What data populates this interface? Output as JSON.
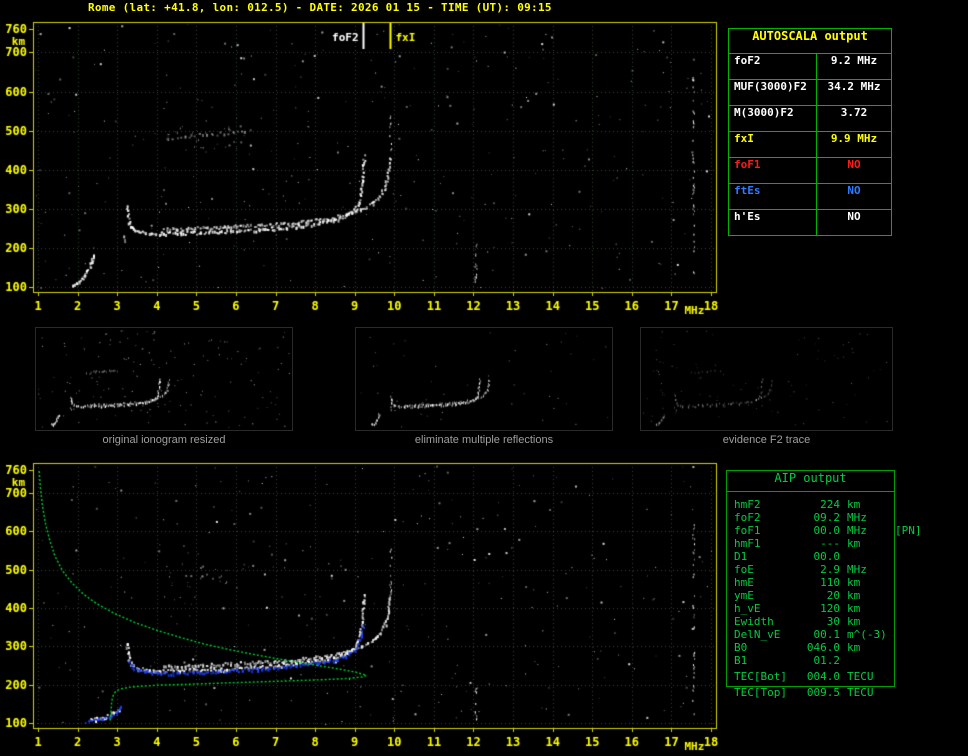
{
  "header": {
    "title": "Rome (lat: +41.8, lon: 012.5) - DATE: 2026 01 15 - TIME (UT): 09:15"
  },
  "colors": {
    "accent_yellow": "#ffff00",
    "plot_border": "#d4d400",
    "table_border_green": "#00b400",
    "aip_green": "#00cc44",
    "trace_white": "#ffffff",
    "restored_blue": "#2244ff",
    "profile_green": "#00cc33",
    "caption_gray": "#9f9f9f",
    "alert_red": "#ff1a1a",
    "info_blue": "#2e7bff"
  },
  "autoscala_table": {
    "title": "AUTOSCALA output",
    "rows": [
      {
        "param": "foF2",
        "value": "9.2 MHz",
        "color": "#ffffff"
      },
      {
        "param": "MUF(3000)F2",
        "value": "34.2 MHz",
        "color": "#ffffff"
      },
      {
        "param": "M(3000)F2",
        "value": "3.72",
        "color": "#ffffff"
      },
      {
        "param": "fxI",
        "value": "9.9 MHz",
        "color": "#ffff00"
      },
      {
        "param": "foF1",
        "value": "NO",
        "color": "#ff1a1a"
      },
      {
        "param": "ftEs",
        "value": "NO",
        "color": "#2e7bff"
      },
      {
        "param": "h'Es",
        "value": "NO",
        "color": "#ffffff"
      }
    ]
  },
  "thumbnails": [
    {
      "caption": "original ionogram resized",
      "style": "original"
    },
    {
      "caption": "eliminate multiple reflections",
      "style": "clean"
    },
    {
      "caption": "evidence F2 trace",
      "style": "faint"
    }
  ],
  "aip_panel": {
    "title": "AIP output",
    "rows": [
      {
        "param": "hmF2",
        "value": "224",
        "unit": "km",
        "extra": ""
      },
      {
        "param": "foF2",
        "value": "09.2",
        "unit": "MHz",
        "extra": ""
      },
      {
        "param": "foF1",
        "value": "00.0",
        "unit": "MHz",
        "extra": "[PN]"
      },
      {
        "param": "hmF1",
        "value": "---",
        "unit": "km",
        "extra": ""
      },
      {
        "param": "D1",
        "value": "00.0",
        "unit": "",
        "extra": ""
      },
      {
        "param": "foE",
        "value": "2.9",
        "unit": "MHz",
        "extra": ""
      },
      {
        "param": "hmE",
        "value": "110",
        "unit": "km",
        "extra": ""
      },
      {
        "param": "ymE",
        "value": "20",
        "unit": "km",
        "extra": ""
      },
      {
        "param": "h_vE",
        "value": "120",
        "unit": "km",
        "extra": ""
      },
      {
        "param": "Ewidth",
        "value": "30",
        "unit": "km",
        "extra": ""
      },
      {
        "param": "DelN_vE",
        "value": "00.1",
        "unit": "m^(-3)",
        "extra": ""
      },
      {
        "param": "B0",
        "value": "046.0",
        "unit": "km",
        "extra": ""
      },
      {
        "param": "B1",
        "value": "01.2",
        "unit": "",
        "extra": ""
      }
    ],
    "tec_bot": {
      "param": "TEC[Bot]",
      "value": "004.0",
      "unit": "TECU",
      "extra": ""
    },
    "tec_top": {
      "param": "TEC[Top]",
      "value": "009.5",
      "unit": "TECU",
      "extra": ""
    }
  },
  "chart_data": [
    {
      "type": "scatter",
      "title": "",
      "xlabel": "MHz",
      "ylabel": "km",
      "xlim": [
        1,
        18
      ],
      "ylim": [
        100,
        760
      ],
      "xticks": [
        1,
        2,
        3,
        4,
        5,
        6,
        7,
        8,
        9,
        10,
        11,
        12,
        13,
        14,
        15,
        16,
        17,
        18
      ],
      "yticks": [
        100,
        200,
        300,
        400,
        500,
        600,
        700,
        760
      ],
      "grid": true,
      "markers": [
        {
          "label": "foF2",
          "x": 9.2,
          "color": "#ffffff",
          "side": "left"
        },
        {
          "label": "fxI",
          "x": 9.9,
          "color": "#ffff00",
          "side": "right"
        }
      ],
      "series": [
        {
          "name": "E-region echo",
          "color": "#ffffff",
          "points": [
            [
              1.88,
              103
            ],
            [
              1.96,
              107
            ],
            [
              2.05,
              113
            ],
            [
              2.13,
              121
            ],
            [
              2.21,
              131
            ],
            [
              2.28,
              143
            ],
            [
              2.34,
              157
            ],
            [
              2.39,
              170
            ],
            [
              2.42,
              180
            ]
          ]
        },
        {
          "name": "retardation dots",
          "color": "#ffffff",
          "alpha": 0.8,
          "spacing": 3,
          "points": [
            [
              3.2,
              228
            ],
            [
              3.22,
              214
            ]
          ]
        },
        {
          "name": "F trace ordinary",
          "color": "#ffffff",
          "points": [
            [
              3.25,
              308
            ],
            [
              3.28,
              282
            ],
            [
              3.32,
              260
            ],
            [
              3.4,
              248
            ],
            [
              3.55,
              241
            ],
            [
              3.75,
              238
            ],
            [
              4.1,
              236
            ],
            [
              4.6,
              236
            ],
            [
              5.1,
              238
            ],
            [
              5.6,
              240
            ],
            [
              6.1,
              243
            ],
            [
              6.6,
              246
            ],
            [
              7.1,
              250
            ],
            [
              7.6,
              255
            ],
            [
              8.1,
              262
            ],
            [
              8.5,
              270
            ],
            [
              8.8,
              281
            ],
            [
              9.0,
              295
            ],
            [
              9.1,
              313
            ],
            [
              9.16,
              340
            ],
            [
              9.2,
              374
            ],
            [
              9.23,
              412
            ],
            [
              9.25,
              434
            ]
          ]
        },
        {
          "name": "F trace extraordinary",
          "color": "#ffffff",
          "alpha": 0.85,
          "points": [
            [
              4.2,
              246
            ],
            [
              4.8,
              248
            ],
            [
              5.4,
              251
            ],
            [
              6.0,
              254
            ],
            [
              6.6,
              257
            ],
            [
              7.2,
              261
            ],
            [
              7.8,
              267
            ],
            [
              8.3,
              274
            ],
            [
              8.8,
              284
            ],
            [
              9.15,
              297
            ],
            [
              9.45,
              313
            ],
            [
              9.65,
              333
            ],
            [
              9.78,
              358
            ],
            [
              9.85,
              392
            ],
            [
              9.89,
              428
            ]
          ]
        },
        {
          "name": "second hop echo",
          "color": "#ffffff",
          "alpha": 0.5,
          "spacing": 4,
          "points": [
            [
              4.3,
              478
            ],
            [
              4.85,
              486
            ],
            [
              5.4,
              490
            ],
            [
              5.95,
              494
            ],
            [
              6.35,
              498
            ]
          ]
        }
      ],
      "noise": {
        "seed": 7,
        "count": 330,
        "streaks": [
          {
            "x": 17.55,
            "km_min": 110,
            "km_max": 640,
            "count": 42
          },
          {
            "x": 12.05,
            "km_min": 105,
            "km_max": 225,
            "count": 14
          },
          {
            "x": 9.9,
            "km_min": 450,
            "km_max": 540,
            "count": 10
          }
        ],
        "clusters": [
          {
            "f_min": 4.2,
            "f_max": 6.4,
            "km_min": 455,
            "km_max": 515,
            "count": 26,
            "alpha": 0.5
          }
        ]
      }
    },
    {
      "type": "scatter",
      "title": "",
      "xlabel": "MHz",
      "ylabel": "km",
      "xlim": [
        1,
        18
      ],
      "ylim": [
        100,
        760
      ],
      "xticks": [
        1,
        2,
        3,
        4,
        5,
        6,
        7,
        8,
        9,
        10,
        11,
        12,
        13,
        14,
        15,
        16,
        17,
        18
      ],
      "yticks": [
        100,
        200,
        300,
        400,
        500,
        600,
        700,
        760
      ],
      "grid": true,
      "markers": [],
      "series": [
        {
          "name": "E-region echo",
          "color": "#ffffff",
          "points": [
            [
              2.32,
              106
            ],
            [
              2.52,
              110
            ],
            [
              2.72,
              116
            ],
            [
              2.92,
              125
            ],
            [
              3.06,
              134
            ]
          ]
        },
        {
          "name": "F trace ordinary",
          "color": "#ffffff",
          "points": [
            [
              3.25,
              308
            ],
            [
              3.28,
              282
            ],
            [
              3.32,
              260
            ],
            [
              3.4,
              248
            ],
            [
              3.55,
              241
            ],
            [
              3.75,
              238
            ],
            [
              4.1,
              236
            ],
            [
              4.6,
              236
            ],
            [
              5.1,
              238
            ],
            [
              5.6,
              240
            ],
            [
              6.1,
              243
            ],
            [
              6.6,
              246
            ],
            [
              7.1,
              250
            ],
            [
              7.6,
              255
            ],
            [
              8.1,
              262
            ],
            [
              8.5,
              270
            ],
            [
              8.8,
              281
            ],
            [
              9.0,
              295
            ],
            [
              9.1,
              313
            ],
            [
              9.16,
              340
            ],
            [
              9.2,
              374
            ],
            [
              9.23,
              412
            ],
            [
              9.25,
              434
            ]
          ]
        },
        {
          "name": "F trace extraordinary",
          "color": "#ffffff",
          "alpha": 0.85,
          "points": [
            [
              4.2,
              246
            ],
            [
              4.8,
              248
            ],
            [
              5.4,
              251
            ],
            [
              6.0,
              254
            ],
            [
              6.6,
              257
            ],
            [
              7.2,
              261
            ],
            [
              7.8,
              267
            ],
            [
              8.3,
              274
            ],
            [
              8.8,
              284
            ],
            [
              9.15,
              297
            ],
            [
              9.45,
              313
            ],
            [
              9.65,
              333
            ],
            [
              9.78,
              358
            ],
            [
              9.85,
              392
            ],
            [
              9.89,
              428
            ]
          ]
        },
        {
          "name": "restored trace",
          "color": "#2244ff",
          "points": [
            [
              3.3,
              262
            ],
            [
              3.4,
              246
            ],
            [
              3.55,
              237
            ],
            [
              3.75,
              232
            ],
            [
              4.05,
              229
            ],
            [
              4.55,
              229
            ],
            [
              5.05,
              231
            ],
            [
              5.55,
              233
            ],
            [
              6.05,
              236
            ],
            [
              6.55,
              239
            ],
            [
              7.05,
              243
            ],
            [
              7.55,
              249
            ],
            [
              8.05,
              255
            ],
            [
              8.45,
              263
            ],
            [
              8.8,
              274
            ],
            [
              9.0,
              287
            ],
            [
              9.1,
              302
            ],
            [
              9.17,
              324
            ],
            [
              9.22,
              350
            ]
          ]
        },
        {
          "name": "restored E layer",
          "color": "#2244ff",
          "points": [
            [
              2.22,
              103
            ],
            [
              2.44,
              106
            ],
            [
              2.66,
              111
            ],
            [
              2.88,
              118
            ],
            [
              3.02,
              127
            ],
            [
              3.12,
              139
            ]
          ]
        },
        {
          "name": "electron density profile",
          "color": "#00cc33",
          "style": "line",
          "points": [
            [
              1.03,
              757
            ],
            [
              1.06,
              716
            ],
            [
              1.11,
              668
            ],
            [
              1.19,
              620
            ],
            [
              1.3,
              575
            ],
            [
              1.44,
              533
            ],
            [
              1.62,
              497
            ],
            [
              1.86,
              465
            ],
            [
              2.15,
              436
            ],
            [
              2.5,
              410
            ],
            [
              2.95,
              385
            ],
            [
              3.45,
              362
            ],
            [
              4.0,
              342
            ],
            [
              4.6,
              323
            ],
            [
              5.2,
              306
            ],
            [
              5.9,
              290
            ],
            [
              6.6,
              276
            ],
            [
              7.3,
              263
            ],
            [
              8.0,
              251
            ],
            [
              8.6,
              241
            ],
            [
              9.0,
              233
            ],
            [
              9.22,
              227
            ],
            [
              9.3,
              224
            ],
            [
              9.18,
              220
            ],
            [
              8.8,
              216
            ],
            [
              8.2,
              213
            ],
            [
              7.4,
              210
            ],
            [
              6.5,
              207
            ],
            [
              5.6,
              204
            ],
            [
              4.8,
              201
            ],
            [
              4.1,
              199
            ],
            [
              3.6,
              196
            ],
            [
              3.3,
              193
            ],
            [
              3.1,
              189
            ],
            [
              2.98,
              184
            ],
            [
              2.92,
              177
            ],
            [
              2.88,
              166
            ],
            [
              2.86,
              153
            ],
            [
              2.85,
              139
            ],
            [
              2.84,
              125
            ],
            [
              2.83,
              111
            ],
            [
              2.82,
              101
            ]
          ]
        }
      ],
      "noise": {
        "seed": 13,
        "count": 300,
        "streaks": [
          {
            "x": 17.55,
            "km_min": 110,
            "km_max": 620,
            "count": 40
          },
          {
            "x": 9.9,
            "km_min": 430,
            "km_max": 560,
            "count": 14
          },
          {
            "x": 12.05,
            "km_min": 105,
            "km_max": 200,
            "count": 10
          }
        ],
        "clusters": [
          {
            "f_min": 4.3,
            "f_max": 6.5,
            "km_min": 455,
            "km_max": 520,
            "count": 24,
            "alpha": 0.45
          }
        ]
      }
    }
  ]
}
